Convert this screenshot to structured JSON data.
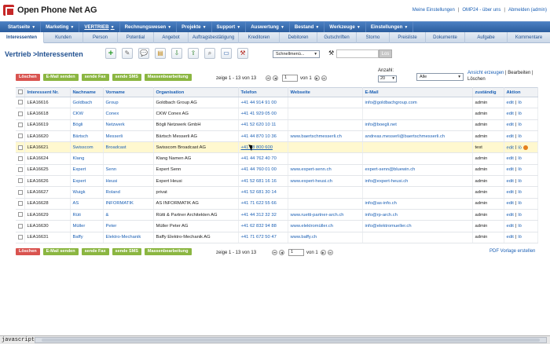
{
  "app": {
    "name": "Open Phone Net AG"
  },
  "toplinks": [
    {
      "label": "Meine Einstellungen"
    },
    {
      "label": "|"
    },
    {
      "label": "OMP24 - über uns"
    },
    {
      "label": "|"
    },
    {
      "label": "Abmelden (admin)"
    }
  ],
  "mainmenu": [
    {
      "label": "Startseite"
    },
    {
      "label": "Marketing"
    },
    {
      "label": "VERTRIEB"
    },
    {
      "label": "Rechnungswesen"
    },
    {
      "label": "Projekte"
    },
    {
      "label": "Support"
    },
    {
      "label": "Auswertung"
    },
    {
      "label": "Bestand"
    },
    {
      "label": "Werkzeuge"
    },
    {
      "label": "Einstellungen"
    }
  ],
  "submenu": [
    {
      "label": "Interessenten"
    },
    {
      "label": "Kunden"
    },
    {
      "label": "Person"
    },
    {
      "label": "Potential"
    },
    {
      "label": "Angebot"
    },
    {
      "label": "Auftragsbestätigung"
    },
    {
      "label": "Kreditoren"
    },
    {
      "label": "Debitoren"
    },
    {
      "label": "Gutschriften"
    },
    {
      "label": "Storno"
    },
    {
      "label": "Preisliste"
    },
    {
      "label": "Dokumente"
    },
    {
      "label": "Aufgabe"
    },
    {
      "label": "Kommentare"
    }
  ],
  "breadcrumb": "Vertrieb >Interessenten",
  "toolbar": {
    "quickmenu": "Schnellmenü...",
    "search_button": "Los",
    "icons": [
      "add-icon",
      "edit-icon",
      "chat-icon",
      "note-icon",
      "import-icon",
      "export-icon",
      "find-icon",
      "monitor-icon",
      "tools-icon"
    ]
  },
  "actions": {
    "delete": "Löschen",
    "email": "E-Mail senden",
    "fax": "sende Fax",
    "sms": "sende SMS",
    "bulk": "Massenbearbeitung"
  },
  "pager": {
    "summary": "zeige 1 - 13 von 13",
    "page": "1",
    "of_label": "von 1"
  },
  "anzahl": {
    "label": "Anzahl:",
    "value": "20"
  },
  "filter": {
    "value": "Alle"
  },
  "view_links": {
    "create": "Ansicht erzeugen",
    "sep1": " | ",
    "edit": "Bearbeiten",
    "sep2": " | ",
    "delete": "Löschen"
  },
  "columns": [
    "Interessent Nr.",
    "Nachname",
    "Vorname",
    "Organisation",
    "Telefon",
    "Webseite",
    "E-Mail",
    "zuständig",
    "Aktion"
  ],
  "rows": [
    {
      "nr": "LEA16616",
      "nachname": "Goldbach",
      "vorname": "Group",
      "org": "Goldbach Group AG",
      "tel": "+41 44 914 91 00",
      "web": "",
      "mail": "info@goldbachgroup.com",
      "zust": "admin",
      "edit": "edit",
      "sep": "|",
      "del": "lö"
    },
    {
      "nr": "LEA16618",
      "nachname": "CKW",
      "vorname": "Conex",
      "org": "CKW Conex AG",
      "tel": "+41 41 929 05 00",
      "web": "",
      "mail": "",
      "zust": "admin",
      "edit": "edit",
      "sep": "|",
      "del": "lö"
    },
    {
      "nr": "LEA16619",
      "nachname": "Bögli",
      "vorname": "Netzwerk",
      "org": "Bögli Netzwerk GmbH",
      "tel": "+41 52 620 10 11",
      "web": "",
      "mail": "info@boegli.net",
      "zust": "admin",
      "edit": "edit",
      "sep": "|",
      "del": "lö"
    },
    {
      "nr": "LEA16620",
      "nachname": "Bärtsch",
      "vorname": "Messerli",
      "org": "Bärtsch Messerli AG",
      "tel": "+41 44 870 10 36",
      "web": "www.baertschmesserli.ch",
      "mail": "andreas.messerli@baertschmesserli.ch",
      "zust": "admin",
      "edit": "edit",
      "sep": "|",
      "del": "lö"
    },
    {
      "nr": "LEA16621",
      "nachname": "Swisscom",
      "vorname": "Broadcast",
      "org": "Swisscom Broadcast AG",
      "tel": "+41 58 800 600",
      "web": "",
      "mail": "",
      "zust": "test",
      "edit": "edit",
      "sep": "|",
      "del": "lö",
      "hl": true
    },
    {
      "nr": "LEA16624",
      "nachname": "Klang",
      "vorname": "",
      "org": "Klang Namen AG",
      "tel": "+41 44 762 40 70",
      "web": "",
      "mail": "",
      "zust": "admin",
      "edit": "edit",
      "sep": "|",
      "del": "lö"
    },
    {
      "nr": "LEA16625",
      "nachname": "Expert",
      "vorname": "Senn",
      "org": "Expert Senn",
      "tel": "+41 44 760 01 00",
      "web": "www.expert-senn.ch",
      "mail": "expert-senn@bluewin.ch",
      "zust": "admin",
      "edit": "edit",
      "sep": "|",
      "del": "lö"
    },
    {
      "nr": "LEA16626",
      "nachname": "Expert",
      "vorname": "Heusi",
      "org": "Expert Heusi",
      "tel": "+41 52 681 16 16",
      "web": "www.expert-heusi.ch",
      "mail": "info@expert-heusi.ch",
      "zust": "admin",
      "edit": "edit",
      "sep": "|",
      "del": "lö"
    },
    {
      "nr": "LEA16627",
      "nachname": "Wuigk",
      "vorname": "Roland",
      "org": "privat",
      "tel": "+41 52 681 30 14",
      "web": "",
      "mail": "",
      "zust": "admin",
      "edit": "edit",
      "sep": "|",
      "del": "lö"
    },
    {
      "nr": "LEA16628",
      "nachname": "AS",
      "vorname": "INFORMATIK",
      "org": "AS INFORMATIK AG",
      "tel": "+41 71 622 55 66",
      "web": "",
      "mail": "info@as-info.ch",
      "zust": "admin",
      "edit": "edit",
      "sep": "|",
      "del": "lö"
    },
    {
      "nr": "LEA16629",
      "nachname": "Rüti",
      "vorname": "&",
      "org": "Rütti & Partner Architekten AG",
      "tel": "+41 44 312 32 32",
      "web": "www.ruetti-partner-arch.ch",
      "mail": "info@rp-arch.ch",
      "zust": "admin",
      "edit": "edit",
      "sep": "|",
      "del": "lö"
    },
    {
      "nr": "LEA16630",
      "nachname": "Müller",
      "vorname": "Peter",
      "org": "Müller Peter AG",
      "tel": "+41 62 832 94 88",
      "web": "www.elektromüller.ch",
      "mail": "info@elektromueller.ch",
      "zust": "admin",
      "edit": "edit",
      "sep": "|",
      "del": "lö"
    },
    {
      "nr": "LEA16631",
      "nachname": "Baffy",
      "vorname": "Elektro-Mechanik",
      "org": "Baffy Elektro-Mechanik AG",
      "tel": "+41 71 672 50 47",
      "web": "www.baffy.ch",
      "mail": "",
      "zust": "admin",
      "edit": "edit",
      "sep": "|",
      "del": "lö"
    }
  ],
  "pdf_link": "PDF Vorlage erstellen",
  "statusbar": {
    "text": "javascript:;"
  }
}
